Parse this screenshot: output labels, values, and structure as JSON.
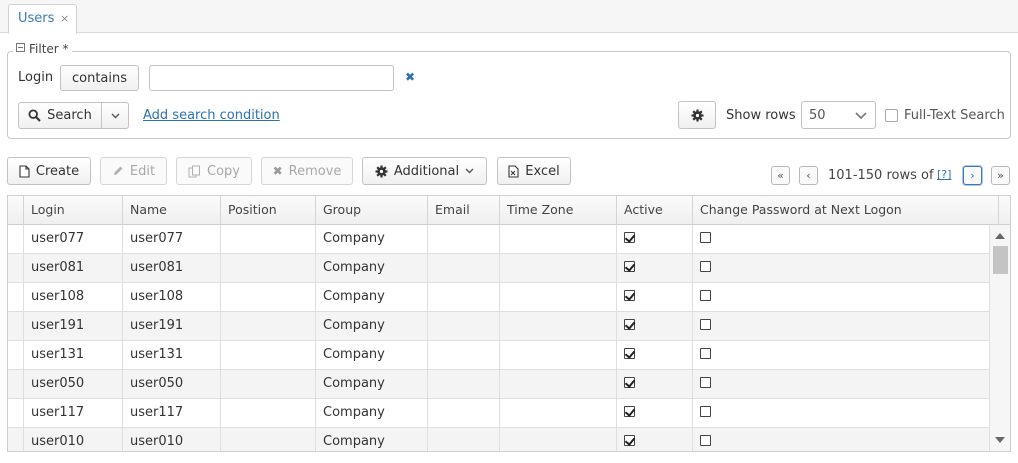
{
  "tab": {
    "label": "Users",
    "close": "×"
  },
  "filter": {
    "legend": "Filter *",
    "condition_label": "Login",
    "operator": "contains",
    "value": "",
    "clear": "✖",
    "search_label": "Search",
    "dropdown_caret": "⌄",
    "add_condition": "Add search condition",
    "show_rows_label": "Show rows",
    "show_rows_value": "50",
    "fulltext_label": "Full-Text Search"
  },
  "toolbar": {
    "create": "Create",
    "edit": "Edit",
    "copy": "Copy",
    "remove": "Remove",
    "additional": "Additional",
    "excel": "Excel"
  },
  "pager": {
    "first": "«",
    "prev": "‹",
    "range_text": "101-150 rows of",
    "total_link": "[?]",
    "next": "›",
    "last": "»"
  },
  "table": {
    "columns": [
      "Login",
      "Name",
      "Position",
      "Group",
      "Email",
      "Time Zone",
      "Active",
      "Change Password at Next Logon"
    ],
    "rows": [
      {
        "login": "user077",
        "name": "user077",
        "position": "",
        "group": "Company",
        "email": "",
        "tz": "",
        "active": true,
        "change_pw": false
      },
      {
        "login": "user081",
        "name": "user081",
        "position": "",
        "group": "Company",
        "email": "",
        "tz": "",
        "active": true,
        "change_pw": false
      },
      {
        "login": "user108",
        "name": "user108",
        "position": "",
        "group": "Company",
        "email": "",
        "tz": "",
        "active": true,
        "change_pw": false
      },
      {
        "login": "user191",
        "name": "user191",
        "position": "",
        "group": "Company",
        "email": "",
        "tz": "",
        "active": true,
        "change_pw": false
      },
      {
        "login": "user131",
        "name": "user131",
        "position": "",
        "group": "Company",
        "email": "",
        "tz": "",
        "active": true,
        "change_pw": false
      },
      {
        "login": "user050",
        "name": "user050",
        "position": "",
        "group": "Company",
        "email": "",
        "tz": "",
        "active": true,
        "change_pw": false
      },
      {
        "login": "user117",
        "name": "user117",
        "position": "",
        "group": "Company",
        "email": "",
        "tz": "",
        "active": true,
        "change_pw": false
      },
      {
        "login": "user010",
        "name": "user010",
        "position": "",
        "group": "Company",
        "email": "",
        "tz": "",
        "active": true,
        "change_pw": false
      }
    ]
  },
  "colors": {
    "accent": "#2b70b8",
    "row_alt": "#f4f4f4",
    "border": "#cfcfcf"
  }
}
